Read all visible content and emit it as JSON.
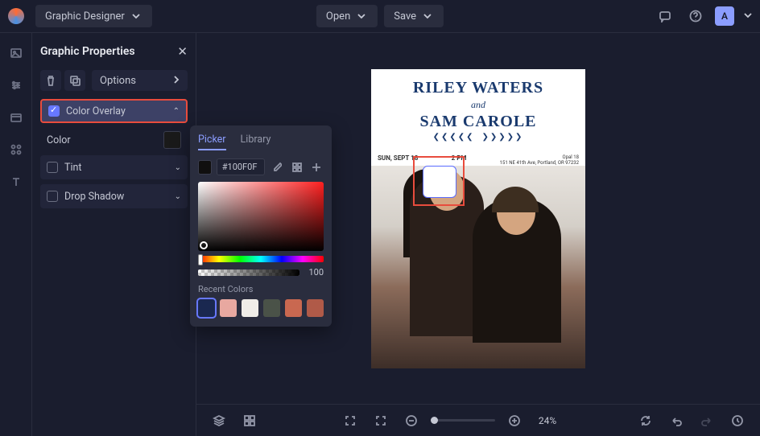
{
  "header": {
    "app_mode": "Graphic Designer",
    "open": "Open",
    "save": "Save",
    "avatar_initial": "A"
  },
  "panel": {
    "title": "Graphic Properties",
    "options": "Options",
    "color_overlay": "Color Overlay",
    "color_label": "Color",
    "tint": "Tint",
    "drop_shadow": "Drop Shadow"
  },
  "picker": {
    "tab_picker": "Picker",
    "tab_library": "Library",
    "hex": "#100F0F",
    "alpha": "100",
    "recent_label": "Recent Colors",
    "recent": [
      "#1a2850",
      "#e8a8a0",
      "#f0ede8",
      "#4a5248",
      "#c96850",
      "#b05a48"
    ]
  },
  "artboard": {
    "name1": "RILEY WATERS",
    "and": "and",
    "name2": "SAM CAROLE",
    "date": "SUN, SEPT 18",
    "time": "2 PM",
    "venue": "Opal 18",
    "address": "151 NE 41th Ave, Portland, OR 97232"
  },
  "bottombar": {
    "zoom": "24%"
  }
}
